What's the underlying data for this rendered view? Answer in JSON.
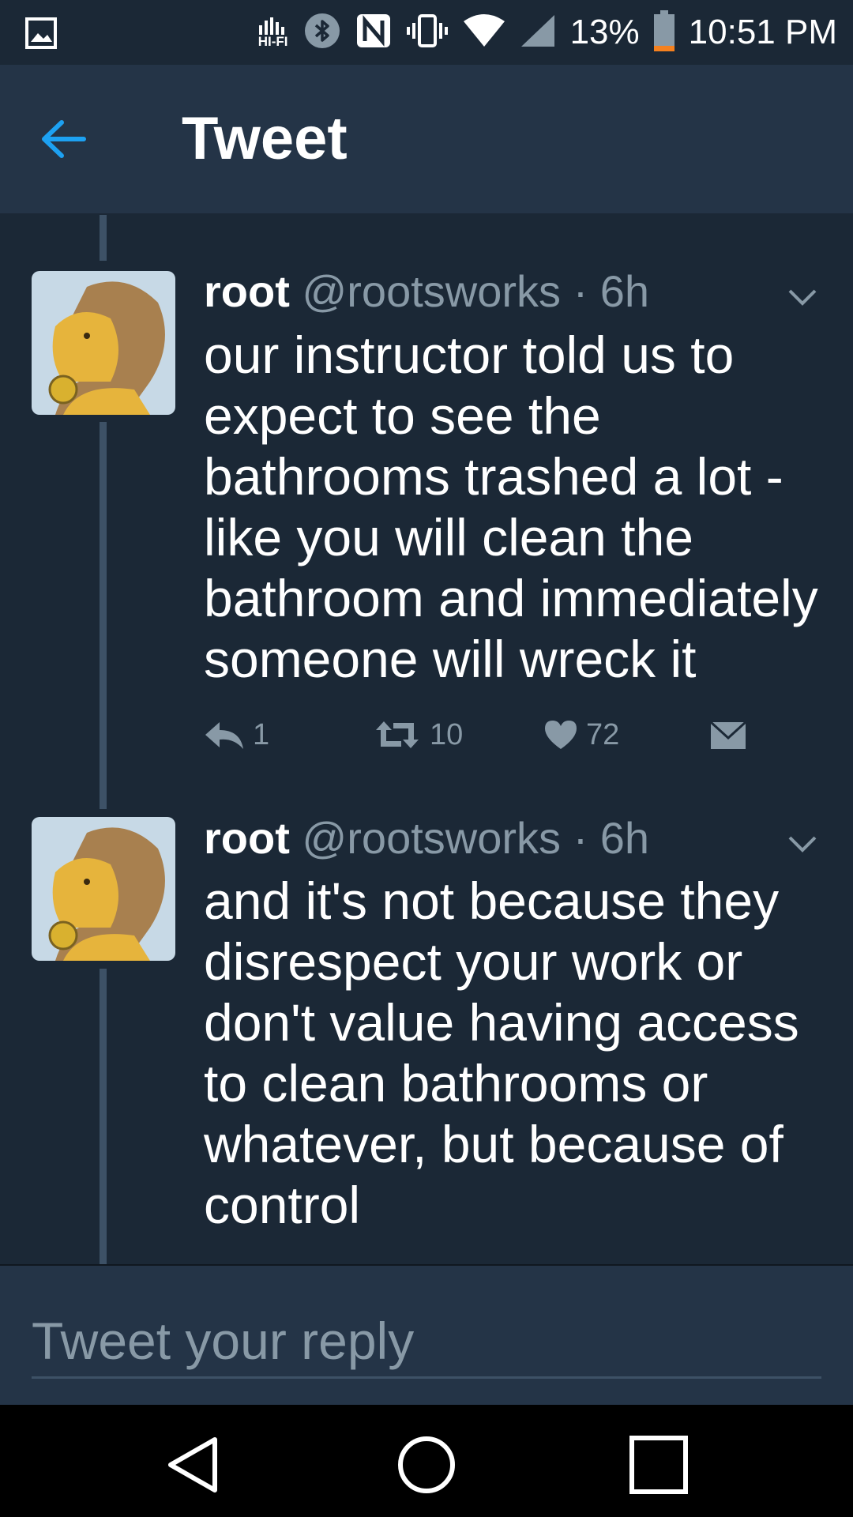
{
  "status_bar": {
    "hifi_label": "HI-FI",
    "battery_percent": "13%",
    "time": "10:51 PM",
    "icons": [
      "gallery-icon",
      "hifi-icon",
      "bluetooth-icon",
      "nfc-icon",
      "vibrate-icon",
      "wifi-icon",
      "signal-icon",
      "battery-icon"
    ]
  },
  "app_bar": {
    "title": "Tweet",
    "back_icon": "arrow-left-icon"
  },
  "tweets": [
    {
      "name": "root",
      "handle": "@rootsworks",
      "time": "· 6h",
      "text": "our instructor told us to expect to see the bathrooms trashed a lot - like you will clean the bathroom and immediately someone will wreck it",
      "replies": "1",
      "retweets": "10",
      "likes": "72"
    },
    {
      "name": "root",
      "handle": "@rootsworks",
      "time": "· 6h",
      "text": "and it's not because they disrespect your work or don't value having access to clean bathrooms or whatever, but because of control"
    }
  ],
  "reply": {
    "placeholder": "Tweet your reply"
  },
  "colors": {
    "background": "#1b2836",
    "bar": "#243447",
    "accent": "#1da1f2",
    "muted": "#8899a6"
  }
}
